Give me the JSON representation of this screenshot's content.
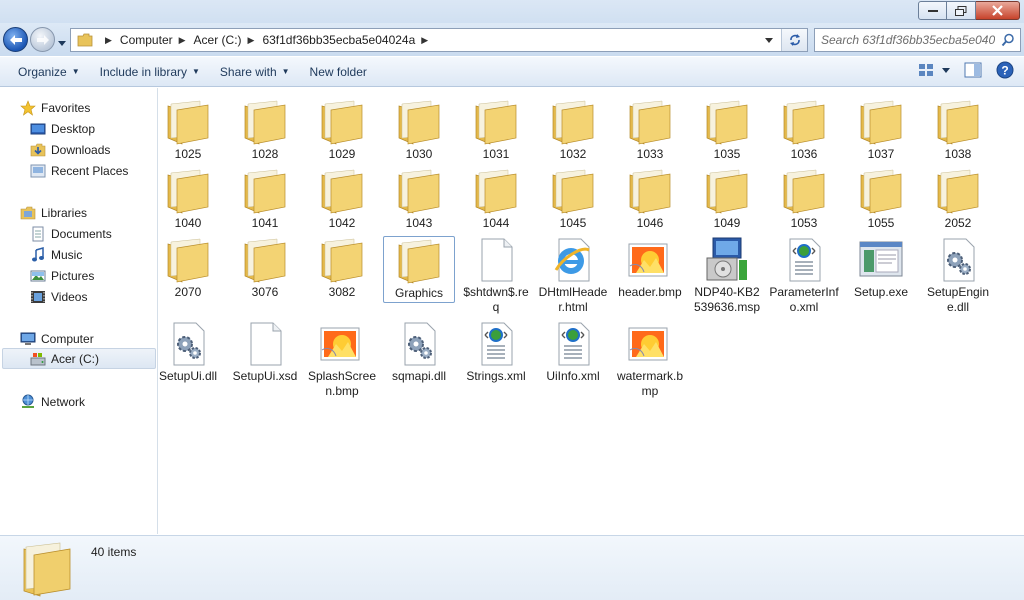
{
  "window": {
    "minimize_label": "minimize",
    "maximize_label": "restore",
    "close_label": "close"
  },
  "address": {
    "crumbs": [
      "Computer",
      "Acer (C:)",
      "63f1df36bb35ecba5e04024a"
    ],
    "search_placeholder": "Search 63f1df36bb35ecba5e040..."
  },
  "toolbar": {
    "organize": "Organize",
    "include": "Include in library",
    "share": "Share with",
    "newfolder": "New folder"
  },
  "nav": {
    "favorites": "Favorites",
    "desktop": "Desktop",
    "downloads": "Downloads",
    "recent": "Recent Places",
    "libraries": "Libraries",
    "documents": "Documents",
    "music": "Music",
    "pictures": "Pictures",
    "videos": "Videos",
    "computer": "Computer",
    "acer": "Acer (C:)",
    "network": "Network"
  },
  "files": [
    {
      "name": "1025",
      "icon": "folder"
    },
    {
      "name": "1028",
      "icon": "folder"
    },
    {
      "name": "1029",
      "icon": "folder"
    },
    {
      "name": "1030",
      "icon": "folder"
    },
    {
      "name": "1031",
      "icon": "folder"
    },
    {
      "name": "1032",
      "icon": "folder"
    },
    {
      "name": "1033",
      "icon": "folder"
    },
    {
      "name": "1035",
      "icon": "folder"
    },
    {
      "name": "1036",
      "icon": "folder"
    },
    {
      "name": "1037",
      "icon": "folder"
    },
    {
      "name": "1038",
      "icon": "folder"
    },
    {
      "name": "1040",
      "icon": "folder"
    },
    {
      "name": "1041",
      "icon": "folder"
    },
    {
      "name": "1042",
      "icon": "folder"
    },
    {
      "name": "1043",
      "icon": "folder"
    },
    {
      "name": "1044",
      "icon": "folder"
    },
    {
      "name": "1045",
      "icon": "folder"
    },
    {
      "name": "1046",
      "icon": "folder"
    },
    {
      "name": "1049",
      "icon": "folder"
    },
    {
      "name": "1053",
      "icon": "folder"
    },
    {
      "name": "1055",
      "icon": "folder"
    },
    {
      "name": "2052",
      "icon": "folder"
    },
    {
      "name": "2070",
      "icon": "folder"
    },
    {
      "name": "3076",
      "icon": "folder"
    },
    {
      "name": "3082",
      "icon": "folder"
    },
    {
      "name": "Graphics",
      "icon": "folder",
      "selected": true
    },
    {
      "name": "$shtdwn$.req",
      "icon": "blank"
    },
    {
      "name": "DHtmlHeader.html",
      "icon": "ie"
    },
    {
      "name": "header.bmp",
      "icon": "bmp"
    },
    {
      "name": "NDP40-KB2539636.msp",
      "icon": "msp"
    },
    {
      "name": "ParameterInfo.xml",
      "icon": "xml"
    },
    {
      "name": "Setup.exe",
      "icon": "exe"
    },
    {
      "name": "SetupEngine.dll",
      "icon": "dll"
    },
    {
      "name": "SetupUi.dll",
      "icon": "dll"
    },
    {
      "name": "SetupUi.xsd",
      "icon": "blank"
    },
    {
      "name": "SplashScreen.bmp",
      "icon": "bmp"
    },
    {
      "name": "sqmapi.dll",
      "icon": "dll"
    },
    {
      "name": "Strings.xml",
      "icon": "xml"
    },
    {
      "name": "UiInfo.xml",
      "icon": "xml"
    },
    {
      "name": "watermark.bmp",
      "icon": "bmp"
    }
  ],
  "details": {
    "count": "40 items"
  }
}
